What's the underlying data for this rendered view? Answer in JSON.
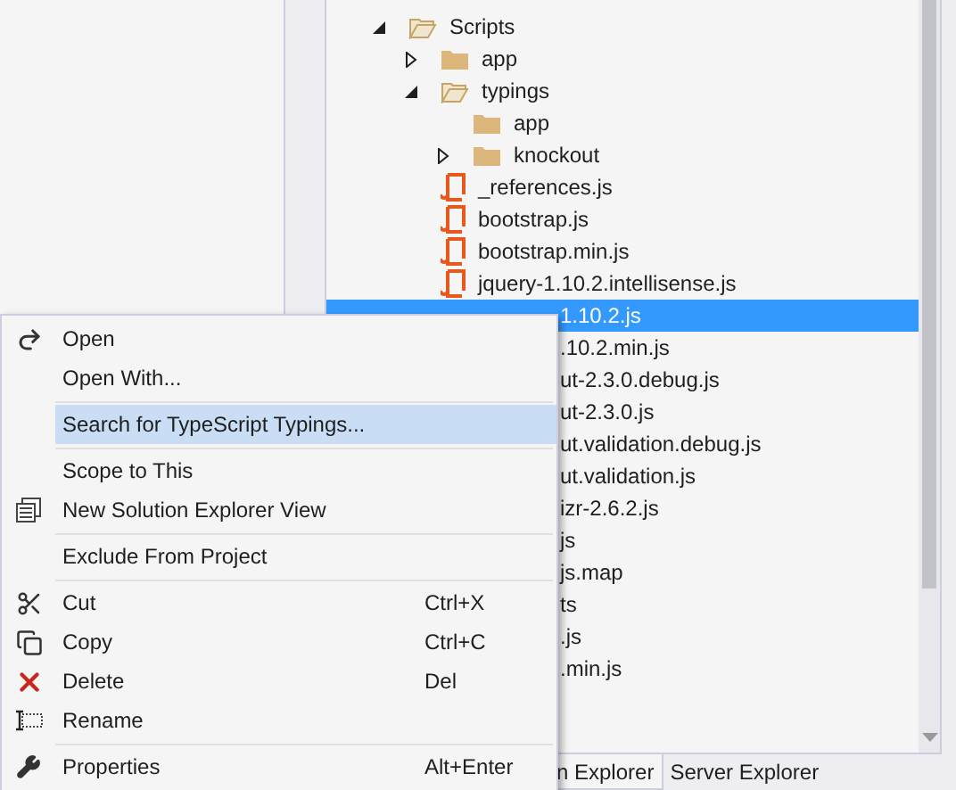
{
  "tree": [
    {
      "kind": "folder",
      "name": "Scripts",
      "expanded": true,
      "children": [
        {
          "kind": "folder",
          "name": "app",
          "expanded": false
        },
        {
          "kind": "folder",
          "name": "typings",
          "expanded": true,
          "children": [
            {
              "kind": "folder",
              "name": "app"
            },
            {
              "kind": "folder",
              "name": "knockout",
              "expanded": false
            }
          ]
        },
        {
          "kind": "file",
          "name": "_references.js",
          "selected": false
        },
        {
          "kind": "file",
          "name": "bootstrap.js",
          "selected": false
        },
        {
          "kind": "file",
          "name": "bootstrap.min.js",
          "selected": false
        },
        {
          "kind": "file",
          "name": "jquery-1.10.2.intellisense.js",
          "selected": false
        },
        {
          "kind": "partial",
          "name": "1.10.2.js",
          "selected": true
        },
        {
          "kind": "partial",
          "name": ".10.2.min.js",
          "selected": false
        },
        {
          "kind": "partial",
          "name": "ut-2.3.0.debug.js",
          "selected": false
        },
        {
          "kind": "partial",
          "name": "ut-2.3.0.js",
          "selected": false
        },
        {
          "kind": "partial",
          "name": "ut.validation.debug.js",
          "selected": false
        },
        {
          "kind": "partial",
          "name": "ut.validation.js",
          "selected": false
        },
        {
          "kind": "partial",
          "name": "izr-2.6.2.js",
          "selected": false
        },
        {
          "kind": "partial",
          "name": "js",
          "selected": false
        },
        {
          "kind": "partial",
          "name": "js.map",
          "selected": false
        },
        {
          "kind": "partial",
          "name": "ts",
          "selected": false
        },
        {
          "kind": "partial",
          "name": ".js",
          "selected": false
        },
        {
          "kind": "partial",
          "name": ".min.js",
          "selected": false
        }
      ]
    }
  ],
  "context_menu": [
    {
      "kind": "item",
      "label": "Open",
      "selected": false
    },
    {
      "kind": "item",
      "label": "Open With...",
      "selected": false
    },
    {
      "kind": "separator"
    },
    {
      "kind": "item",
      "label": "Search for TypeScript Typings...",
      "selected": true
    },
    {
      "kind": "separator"
    },
    {
      "kind": "item",
      "label": "Scope to This",
      "selected": false
    },
    {
      "kind": "item",
      "label": "New Solution Explorer View",
      "selected": false
    },
    {
      "kind": "separator"
    },
    {
      "kind": "item",
      "label": "Exclude From Project",
      "selected": false
    },
    {
      "kind": "separator"
    },
    {
      "kind": "item",
      "label": "Cut",
      "shortcut": "Ctrl+X",
      "selected": false
    },
    {
      "kind": "item",
      "label": "Copy",
      "shortcut": "Ctrl+C",
      "selected": false
    },
    {
      "kind": "item",
      "label": "Delete",
      "shortcut": "Del",
      "selected": false
    },
    {
      "kind": "item",
      "label": "Rename",
      "selected": false
    },
    {
      "kind": "separator"
    },
    {
      "kind": "item",
      "label": "Properties",
      "shortcut": "Alt+Enter",
      "selected": false
    }
  ],
  "bottom_tabs": [
    {
      "label": "n Explorer",
      "selected": true
    },
    {
      "label": "Server Explorer",
      "selected": false
    }
  ]
}
